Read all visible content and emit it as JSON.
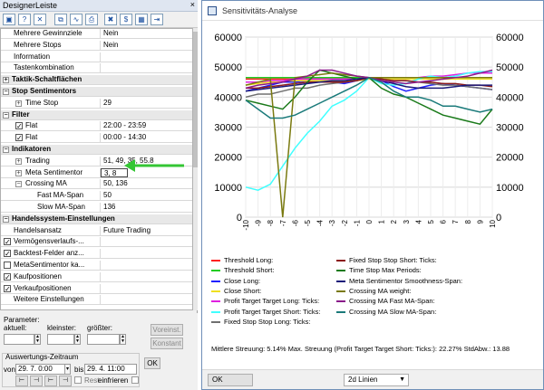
{
  "designer": {
    "title": "DesignerLeiste",
    "close_glyph": "×",
    "toolbar_icons": [
      "new-icon",
      "help-icon",
      "delete-icon",
      "copy-icon",
      "chart-icon",
      "print-icon",
      "x-icon",
      "dollar-icon",
      "table-icon",
      "export-icon"
    ],
    "rows": [
      {
        "label": "Mehrere Gewinnziele",
        "value": "Nein",
        "kind": "item"
      },
      {
        "label": "Mehrere Stops",
        "value": "Nein",
        "kind": "item"
      },
      {
        "label": "Information",
        "value": "",
        "kind": "item"
      },
      {
        "label": "Tastenkombination",
        "value": "",
        "kind": "item"
      },
      {
        "label": "Taktik-Schaltflächen",
        "value": "",
        "kind": "cat-plus"
      },
      {
        "label": "Stop Sentimentors",
        "value": "",
        "kind": "cat-minus"
      },
      {
        "label": "Time Stop",
        "value": "29",
        "kind": "sub-plus"
      },
      {
        "label": "Filter",
        "value": "",
        "kind": "cat-minus"
      },
      {
        "label": "Flat",
        "value": "22:00 - 23:59",
        "kind": "sub-check"
      },
      {
        "label": "Flat",
        "value": "00:00 - 14:30",
        "kind": "sub-check"
      },
      {
        "label": "Indikatoren",
        "value": "",
        "kind": "cat-minus"
      },
      {
        "label": "Trading",
        "value": "51, 49, 35, 55.8",
        "kind": "sub-plus"
      },
      {
        "label": "Meta Sentimentor",
        "value": "3, 8",
        "kind": "sub-plus-sel"
      },
      {
        "label": "Crossing MA",
        "value": "50, 136",
        "kind": "sub-minus"
      },
      {
        "label": "Fast MA-Span",
        "value": "50",
        "kind": "sub2"
      },
      {
        "label": "Slow MA-Span",
        "value": "136",
        "kind": "sub2"
      },
      {
        "label": "Handelssystem-Einstellungen",
        "value": "",
        "kind": "cat-minus"
      },
      {
        "label": "Handelsansatz",
        "value": "Future Trading",
        "kind": "item"
      },
      {
        "label": "Vermögensverlaufs-...",
        "value": "",
        "kind": "check"
      },
      {
        "label": "Backtest-Felder anz...",
        "value": "",
        "kind": "check"
      },
      {
        "label": "MetaSentimentor ka...",
        "value": "",
        "kind": "uncheck"
      },
      {
        "label": "Kaufpositionen",
        "value": "",
        "kind": "check"
      },
      {
        "label": "Verkaufpositionen",
        "value": "",
        "kind": "check"
      },
      {
        "label": "Weitere Einstellungen",
        "value": "",
        "kind": "item"
      }
    ],
    "params": {
      "title": "Parameter:",
      "aktuell": "aktuell:",
      "kleinster": "kleinster:",
      "groesster": "größter:",
      "voreinst": "Voreinst.",
      "konstant": "Konstant"
    },
    "zeitraum": {
      "title": "Auswertungs-Zeitraum",
      "von_label": "von:",
      "von_value": "29. 7. 0:00",
      "bis_label": "bis:",
      "bis_value": "29. 4. 11:00",
      "rest_label": "Rest",
      "einfrieren_label": "einfrieren",
      "ok_label": "OK"
    },
    "checkmark": "✓"
  },
  "analysis": {
    "title": "Sensitivitäts-Analyse",
    "ok_label": "OK",
    "dim_select": "2d Linien",
    "stats": "Mittlere Streuung: 5.14%  Max. Streuung (Profit Target Target Short: Ticks:): 22.27%  StdAbw.: 13.88",
    "legend": [
      {
        "name": "Threshold Long:",
        "color": "#ff2020"
      },
      {
        "name": "Threshold Short:",
        "color": "#22cc22"
      },
      {
        "name": "Close Long:",
        "color": "#2020ff"
      },
      {
        "name": "Close Short:",
        "color": "#f0e020"
      },
      {
        "name": "Profit Target Target Long: Ticks:",
        "color": "#e020e0"
      },
      {
        "name": "Profit Target Target Short: Ticks:",
        "color": "#40ffff"
      },
      {
        "name": "Fixed Stop Stop Long: Ticks:",
        "color": "#707070"
      },
      {
        "name": "Fixed Stop Stop Short: Ticks:",
        "color": "#8b1a1a"
      },
      {
        "name": "Time Stop Max Periods:",
        "color": "#1a7a1a"
      },
      {
        "name": "Meta Sentimentor Smoothness-Span:",
        "color": "#1a1a7a"
      },
      {
        "name": "Crossing MA weight:",
        "color": "#7a7a10"
      },
      {
        "name": "Crossing MA Fast MA-Span:",
        "color": "#8a1a8a"
      },
      {
        "name": "Crossing MA Slow MA-Span:",
        "color": "#1a7a7a"
      }
    ]
  },
  "chart_data": {
    "type": "line",
    "title": "",
    "xlabel": "",
    "ylabel": "",
    "x": [
      -10,
      -9,
      -8,
      -7,
      -6,
      -5,
      -4,
      -3,
      -2,
      -1,
      0,
      1,
      2,
      3,
      4,
      5,
      6,
      7,
      8,
      9,
      10
    ],
    "x_tick_labels": [
      "-10",
      "-9",
      "-8",
      "-7",
      "-6",
      "-5",
      "-4",
      "-3",
      "-2",
      "-1",
      "0",
      "1",
      "2",
      "3",
      "4",
      "5",
      "6",
      "7",
      "8",
      "9",
      "10"
    ],
    "ylim": [
      0,
      60000
    ],
    "y_ticks": [
      0,
      10000,
      20000,
      30000,
      40000,
      50000,
      60000
    ],
    "grid": true,
    "right_axis": true,
    "series": [
      {
        "name": "Threshold Long:",
        "color": "#ff2020",
        "values": [
          46000,
          46000,
          46000,
          46000,
          46000,
          46000,
          46000,
          46000,
          46000,
          46000,
          46500,
          46500,
          46500,
          46500,
          46500,
          46500,
          46500,
          46500,
          46500,
          46500,
          46500
        ]
      },
      {
        "name": "Threshold Short:",
        "color": "#22cc22",
        "values": [
          46500,
          46500,
          46500,
          46500,
          46500,
          46500,
          46500,
          46500,
          46500,
          46500,
          46500,
          46500,
          46500,
          46500,
          46500,
          46500,
          46500,
          46500,
          46500,
          46500,
          46500
        ]
      },
      {
        "name": "Close Long:",
        "color": "#2020ff",
        "values": [
          42000,
          43000,
          44000,
          45000,
          45000,
          45500,
          45500,
          45000,
          44500,
          45500,
          46500,
          45500,
          43500,
          42000,
          43000,
          44000,
          44500,
          44000,
          43500,
          43000,
          42500
        ]
      },
      {
        "name": "Close Short:",
        "color": "#f0e020",
        "values": [
          44000,
          44500,
          45000,
          45500,
          45500,
          45500,
          45500,
          45500,
          45500,
          45500,
          46000,
          46000,
          46000,
          46000,
          46000,
          46000,
          46000,
          46000,
          46000,
          46000,
          46000
        ]
      },
      {
        "name": "Profit Target Target Long: Ticks:",
        "color": "#e020e0",
        "values": [
          45000,
          45000,
          45500,
          45500,
          46000,
          46000,
          46000,
          46000,
          46000,
          46000,
          46500,
          46500,
          46500,
          46500,
          46500,
          47000,
          47000,
          47500,
          48000,
          48000,
          48000
        ]
      },
      {
        "name": "Profit Target Target Short: Ticks:",
        "color": "#40ffff",
        "values": [
          10000,
          9000,
          11000,
          17000,
          23000,
          28000,
          32000,
          37000,
          39000,
          42000,
          46500,
          44500,
          44000,
          44500,
          46000,
          47000,
          46500,
          47000,
          48000,
          48500,
          48500
        ]
      },
      {
        "name": "Fixed Stop Stop Long: Ticks:",
        "color": "#707070",
        "values": [
          40000,
          41000,
          41000,
          42000,
          43000,
          43000,
          44000,
          44500,
          45000,
          45500,
          46500,
          46000,
          45500,
          45500,
          45000,
          44500,
          44000,
          44000,
          43500,
          43000,
          42500
        ]
      },
      {
        "name": "Fixed Stop Stop Short: Ticks:",
        "color": "#8b1a1a",
        "values": [
          43000,
          43000,
          43500,
          44000,
          44500,
          45000,
          45000,
          45000,
          45000,
          45500,
          46500,
          46000,
          45500,
          45500,
          45000,
          45000,
          44500,
          44500,
          44000,
          44000,
          43500
        ]
      },
      {
        "name": "Time Stop Max Periods:",
        "color": "#1a7a1a",
        "values": [
          39000,
          38000,
          37000,
          36000,
          40000,
          45000,
          49000,
          48000,
          47000,
          46000,
          46500,
          43000,
          41000,
          40000,
          38000,
          36000,
          34000,
          33000,
          32000,
          31000,
          36000
        ]
      },
      {
        "name": "Meta Sentimentor Smoothness-Span:",
        "color": "#1a1a7a",
        "values": [
          42000,
          42500,
          43000,
          43500,
          44000,
          44500,
          45000,
          45500,
          45500,
          46000,
          46500,
          45500,
          44500,
          43500,
          43000,
          43000,
          43000,
          43500,
          44000,
          44000,
          44000
        ]
      },
      {
        "name": "Crossing MA weight:",
        "color": "#7a7a10",
        "values": [
          44000,
          45000,
          46000,
          0,
          46500,
          47000,
          47500,
          48000,
          47500,
          47000,
          46500,
          46500,
          46500,
          46500,
          46500,
          46500,
          46500,
          46500,
          46500,
          46500,
          46500
        ]
      },
      {
        "name": "Crossing MA Fast MA-Span:",
        "color": "#8a1a8a",
        "values": [
          43000,
          44000,
          44500,
          45000,
          46000,
          47000,
          49000,
          49000,
          48000,
          47000,
          46500,
          45500,
          45000,
          44500,
          45000,
          45500,
          46000,
          46500,
          47000,
          48000,
          49000
        ]
      },
      {
        "name": "Crossing MA Slow MA-Span:",
        "color": "#1a7a7a",
        "values": [
          39000,
          36000,
          33000,
          33000,
          34000,
          36000,
          38000,
          40000,
          42000,
          44000,
          46500,
          45000,
          42000,
          40000,
          40000,
          39000,
          37000,
          37000,
          36000,
          35000,
          36000
        ]
      }
    ]
  }
}
